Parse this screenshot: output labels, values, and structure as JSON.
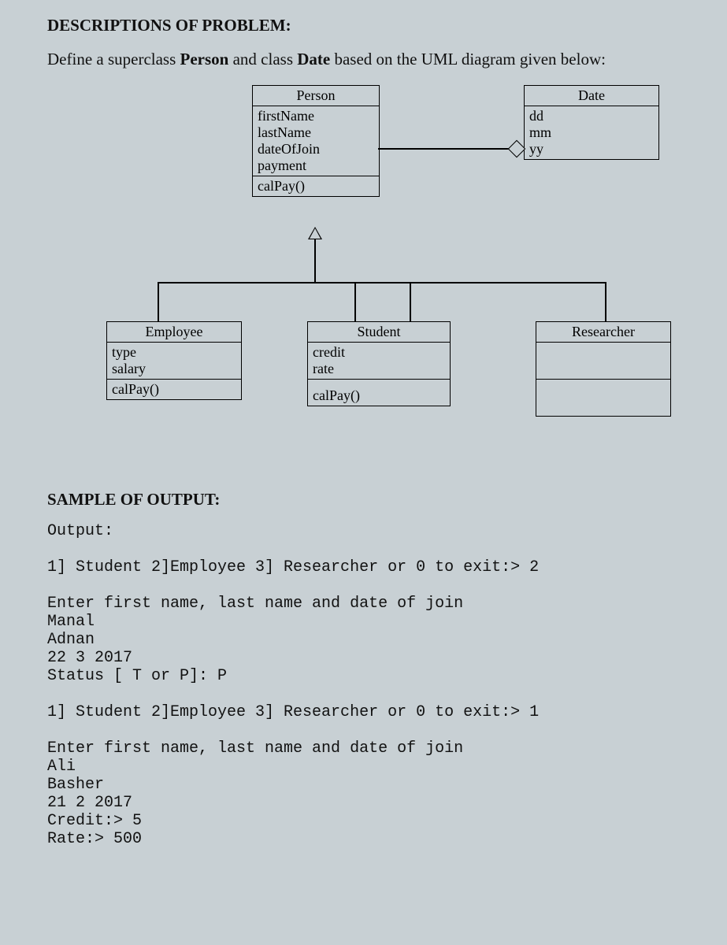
{
  "headings": {
    "descriptions": "DESCRIPTIONS OF PROBLEM:",
    "sample": "SAMPLE OF OUTPUT:"
  },
  "instruction": {
    "prefix": "Define a superclass ",
    "c1": "Person",
    "mid": " and class ",
    "c2": "Date",
    "suffix": " based on the UML diagram given below:"
  },
  "uml": {
    "person": {
      "name": "Person",
      "attrs": [
        "firstName",
        "lastName",
        "dateOfJoin",
        "payment"
      ],
      "ops": [
        "calPay()"
      ]
    },
    "date": {
      "name": "Date",
      "attrs": [
        "dd",
        "mm",
        "yy"
      ],
      "ops": []
    },
    "employee": {
      "name": "Employee",
      "attrs": [
        "type",
        "salary"
      ],
      "ops": [
        "calPay()"
      ]
    },
    "student": {
      "name": "Student",
      "attrs": [
        "credit",
        "rate"
      ],
      "ops": [
        "calPay()"
      ]
    },
    "researcher": {
      "name": "Researcher",
      "attrs": [],
      "ops": []
    }
  },
  "output": "Output:\n\n1] Student 2]Employee 3] Researcher or 0 to exit:> 2\n\nEnter first name, last name and date of join\nManal\nAdnan\n22 3 2017\nStatus [ T or P]: P\n\n1] Student 2]Employee 3] Researcher or 0 to exit:> 1\n\nEnter first name, last name and date of join\nAli\nBasher\n21 2 2017\nCredit:> 5\nRate:> 500"
}
